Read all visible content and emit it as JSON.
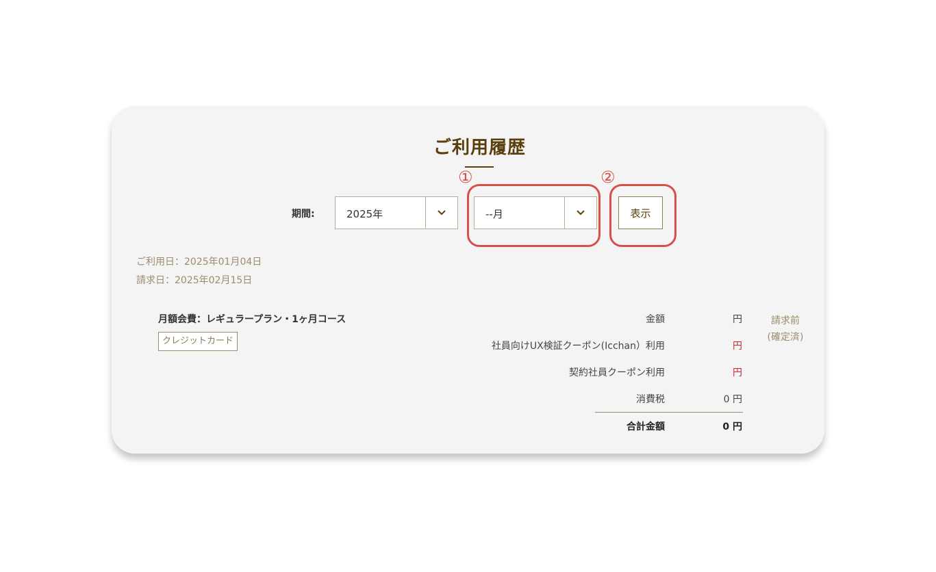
{
  "page": {
    "title": "ご利用履歴"
  },
  "filter": {
    "period_label": "期間:",
    "year_value": "2025年",
    "month_value": "--月",
    "show_button_label": "表示"
  },
  "annotations": {
    "marker_1": "①",
    "marker_2": "②",
    "color": "#d6504a"
  },
  "history": {
    "usage_date": "ご利用日：2025年01月04日",
    "billing_date": "請求日：2025年02月15日",
    "item_name": "月額会費：レギュラープラン・1ヶ月コース",
    "payment_method": "クレジットカード",
    "rows": [
      {
        "label": "金額",
        "amount": "円"
      },
      {
        "label": "社員向けUX検証クーポン(Icchan）利用",
        "amount": "円"
      },
      {
        "label": "契約社員クーポン利用",
        "amount": "円"
      },
      {
        "label": "消費税",
        "amount": "0 円"
      },
      {
        "label": "合計金額",
        "amount": "0 円"
      }
    ],
    "status_line1": "請求前",
    "status_line2": "(確定済)"
  },
  "colors": {
    "brand_brown": "#5b3e0e",
    "discount_red": "#c8292b",
    "muted_text": "#9c8c6c",
    "card_bg": "#f4f4f4"
  }
}
